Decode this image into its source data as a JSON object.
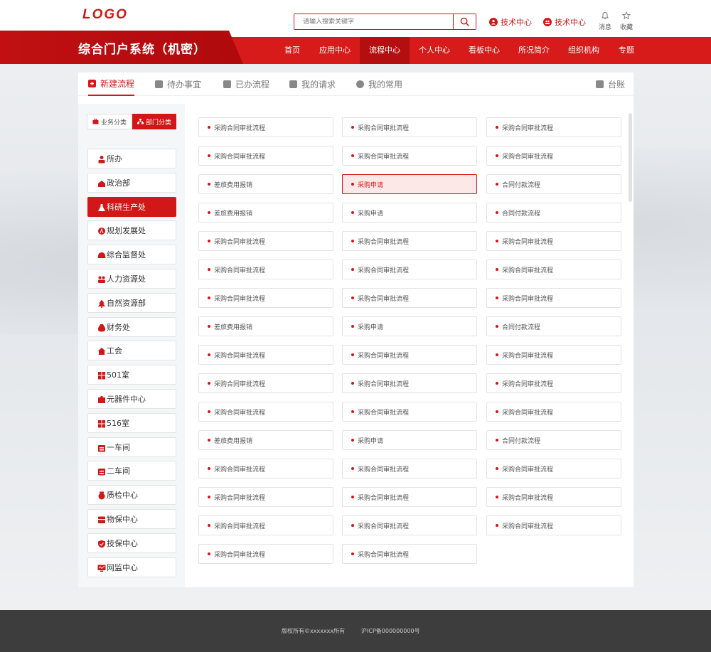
{
  "header": {
    "logo": "LOGO",
    "search": {
      "placeholder": "请输入搜索关键字"
    },
    "tech_links": [
      "技术中心",
      "技术中心"
    ],
    "messages_label": "消息",
    "favorites_label": "收藏"
  },
  "nav": {
    "site_title": "综合门户系统（机密）",
    "items": [
      "首页",
      "应用中心",
      "流程中心",
      "个人中心",
      "看板中心",
      "所况简介",
      "组织机构",
      "专题"
    ],
    "active_index": 2
  },
  "tabs": {
    "items": [
      "新建流程",
      "待办事宜",
      "已办流程",
      "我的请求",
      "我的常用"
    ],
    "ledger": "台账",
    "active_index": 0
  },
  "category_toggle": {
    "business": "业务分类",
    "department": "部门分类",
    "active": "department"
  },
  "departments": [
    {
      "label": "所办",
      "icon": "person-icon"
    },
    {
      "label": "政治部",
      "icon": "inbox-icon"
    },
    {
      "label": "科研生产处",
      "icon": "flask-icon",
      "active": true
    },
    {
      "label": "规划发展处",
      "icon": "compass-icon"
    },
    {
      "label": "综合监督处",
      "icon": "helmet-icon"
    },
    {
      "label": "人力资源处",
      "icon": "people-icon"
    },
    {
      "label": "自然资源部",
      "icon": "tree-icon"
    },
    {
      "label": "财务处",
      "icon": "money-bag-icon"
    },
    {
      "label": "工会",
      "icon": "home-icon"
    },
    {
      "label": "501室",
      "icon": "building-icon"
    },
    {
      "label": "元器件中心",
      "icon": "puzzle-icon"
    },
    {
      "label": "516室",
      "icon": "building-icon"
    },
    {
      "label": "一车间",
      "icon": "factory-icon"
    },
    {
      "label": "二车间",
      "icon": "factory-icon"
    },
    {
      "label": "质检中心",
      "icon": "medal-icon"
    },
    {
      "label": "物保中心",
      "icon": "box-icon"
    },
    {
      "label": "技保中心",
      "icon": "shield-icon"
    },
    {
      "label": "网监中心",
      "icon": "monitor-icon"
    }
  ],
  "flows": [
    [
      "采购合同审批流程",
      "采购合同审批流程",
      "采购合同审批流程"
    ],
    [
      "采购合同审批流程",
      "采购合同审批流程",
      "采购合同审批流程"
    ],
    [
      "差旅费用报销",
      "采购申请",
      "合同付款流程"
    ],
    [
      "差旅费用报销",
      "采购申请",
      "合同付款流程"
    ],
    [
      "采购合同审批流程",
      "采购合同审批流程",
      "采购合同审批流程"
    ],
    [
      "采购合同审批流程",
      "采购合同审批流程",
      "采购合同审批流程"
    ],
    [
      "采购合同审批流程",
      "采购合同审批流程",
      "采购合同审批流程"
    ],
    [
      "差旅费用报销",
      "采购申请",
      "合同付款流程"
    ],
    [
      "采购合同审批流程",
      "采购合同审批流程",
      "采购合同审批流程"
    ],
    [
      "采购合同审批流程",
      "采购合同审批流程",
      "采购合同审批流程"
    ],
    [
      "采购合同审批流程",
      "采购合同审批流程",
      "采购合同审批流程"
    ],
    [
      "差旅费用报销",
      "采购申请",
      "合同付款流程"
    ],
    [
      "采购合同审批流程",
      "采购合同审批流程",
      "采购合同审批流程"
    ],
    [
      "采购合同审批流程",
      "采购合同审批流程",
      "采购合同审批流程"
    ],
    [
      "采购合同审批流程",
      "采购合同审批流程",
      "采购合同审批流程"
    ],
    [
      "采购合同审批流程",
      "采购合同审批流程"
    ]
  ],
  "active_flow": [
    2,
    1
  ],
  "footer": {
    "copyright": "版权所有©xxxxxxx所有",
    "icp": "沪ICP备000000000号"
  },
  "colors": {
    "brand": "#d21718",
    "nav": "#d71b1b",
    "nav_active": "#b30f11",
    "footer": "#3d3d3d"
  }
}
